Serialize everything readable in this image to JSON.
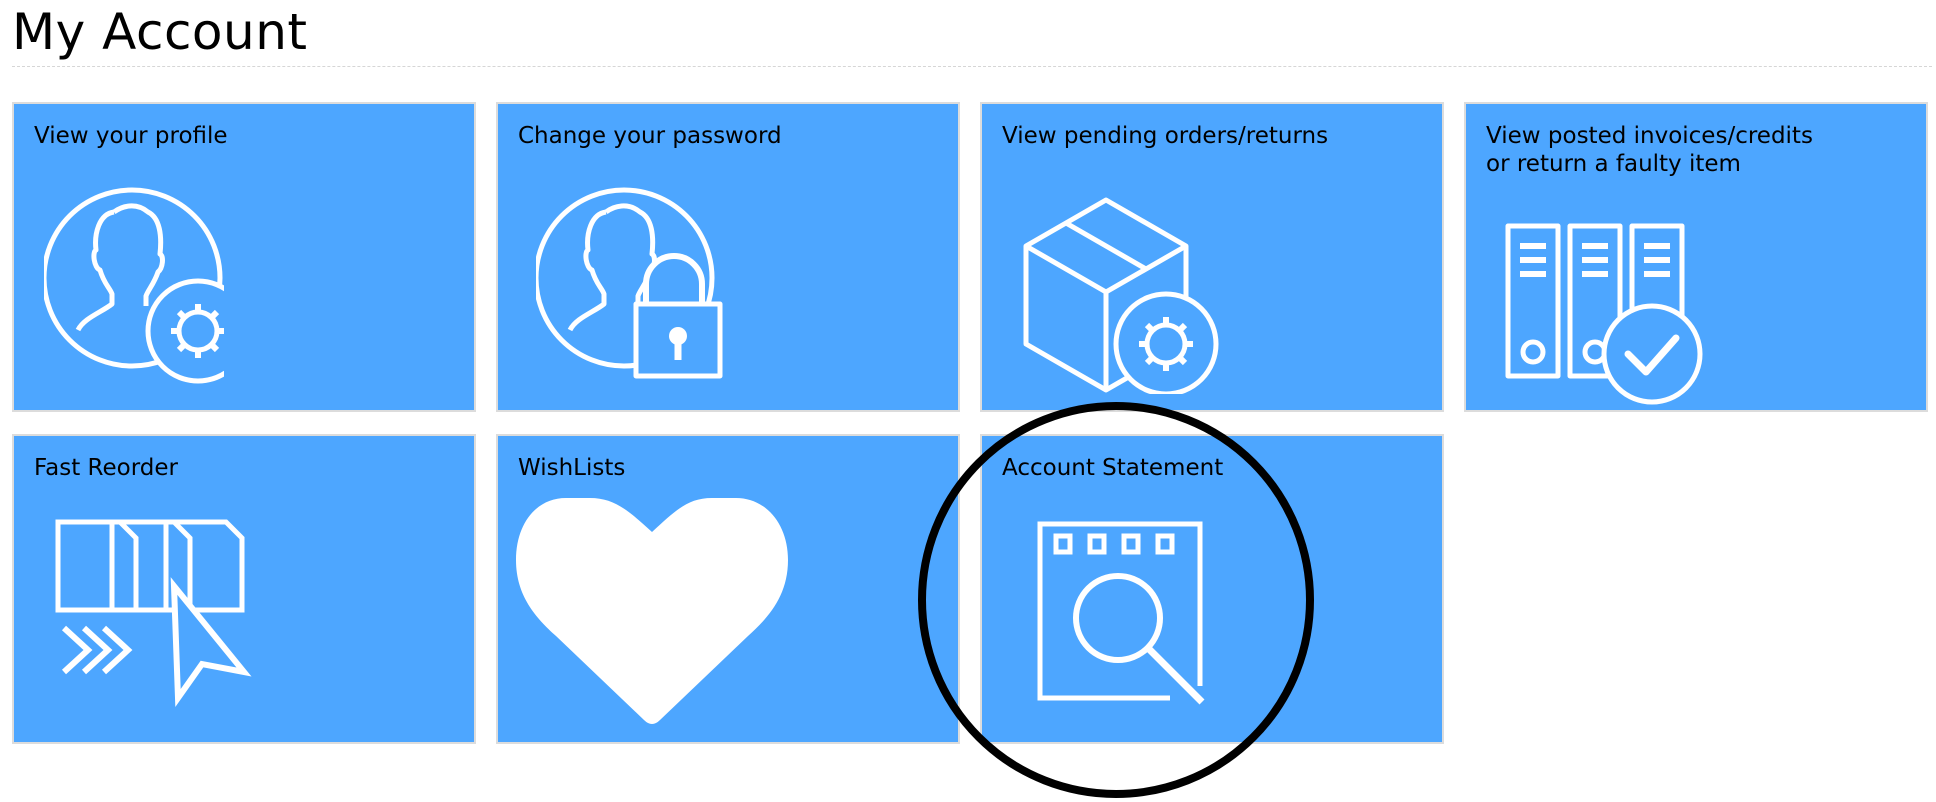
{
  "page": {
    "title": "My Account"
  },
  "theme": {
    "tile_color": "#4da6ff",
    "icon_color": "#ffffff",
    "border_color": "#dcdcdc"
  },
  "tiles": [
    {
      "label": "View your profile",
      "icon": "user-gear-icon"
    },
    {
      "label": "Change your password",
      "icon": "user-lock-icon"
    },
    {
      "label": "View pending orders/returns",
      "icon": "box-gear-icon"
    },
    {
      "label": "View posted invoices/credits\nor return a faulty item",
      "icon": "binders-check-icon"
    },
    {
      "label": "Fast Reorder",
      "icon": "documents-cursor-icon"
    },
    {
      "label": "WishLists",
      "icon": "heart-icon"
    },
    {
      "label": "Account Statement",
      "icon": "notepad-search-icon"
    }
  ],
  "annotation": {
    "shape": "circle",
    "color": "#000000",
    "target": "Account Statement"
  }
}
